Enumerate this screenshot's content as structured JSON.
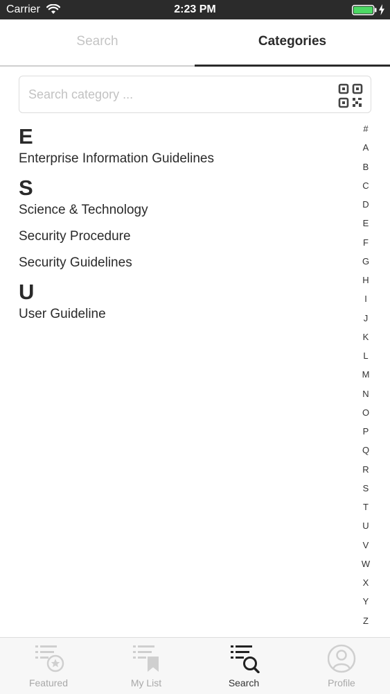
{
  "status_bar": {
    "carrier": "Carrier",
    "time": "2:23 PM"
  },
  "tabs": {
    "search_label": "Search",
    "categories_label": "Categories",
    "active": "Categories"
  },
  "search": {
    "placeholder": "Search category ...",
    "value": ""
  },
  "sections": [
    {
      "letter": "E",
      "items": [
        "Enterprise Information Guidelines"
      ]
    },
    {
      "letter": "S",
      "items": [
        "Science & Technology",
        "Security Procedure",
        "Security Guidelines"
      ]
    },
    {
      "letter": "U",
      "items": [
        "User Guideline"
      ]
    }
  ],
  "alphabet_index": [
    "#",
    "A",
    "B",
    "C",
    "D",
    "E",
    "F",
    "G",
    "H",
    "I",
    "J",
    "K",
    "L",
    "M",
    "N",
    "O",
    "P",
    "Q",
    "R",
    "S",
    "T",
    "U",
    "V",
    "W",
    "X",
    "Y",
    "Z"
  ],
  "bottom_nav": [
    {
      "label": "Featured",
      "icon": "featured-list-icon",
      "active": false
    },
    {
      "label": "My List",
      "icon": "my-list-bookmark-icon",
      "active": false
    },
    {
      "label": "Search",
      "icon": "search-list-icon",
      "active": true
    },
    {
      "label": "Profile",
      "icon": "profile-icon",
      "active": false
    }
  ],
  "colors": {
    "status_bar_bg": "#2b2b2b",
    "battery_green": "#4cd964",
    "text_dark": "#2a2a2a",
    "inactive_gray": "#a8a8a8"
  }
}
